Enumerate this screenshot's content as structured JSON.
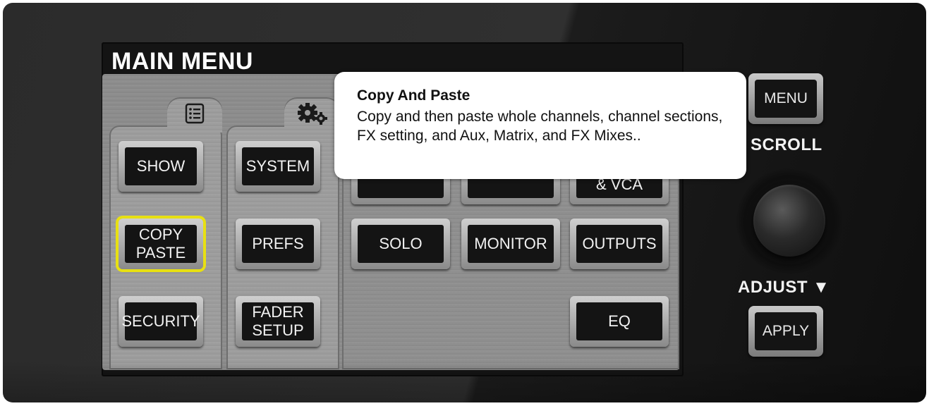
{
  "screen": {
    "title": "MAIN MENU"
  },
  "menu": {
    "col1": [
      "SHOW",
      "COPY\nPASTE",
      "SECURITY"
    ],
    "col2": [
      "SYSTEM",
      "PREFS",
      "FADER\nSETUP"
    ],
    "col3": [
      "",
      "SOLO"
    ],
    "col4": [
      "",
      "MONITOR"
    ],
    "col5": [
      "& VCA",
      "OUTPUTS",
      "EQ"
    ],
    "selected": "COPY\nPASTE",
    "selected_color": "#e8e012"
  },
  "tabs": {
    "left_icon": "list-settings-icon",
    "right_icon": "gears-icon"
  },
  "tooltip": {
    "title": "Copy And Paste",
    "text": "Copy and then paste whole channels, channel sections, FX setting, and Aux, Matrix, and FX Mixes.."
  },
  "controls": {
    "menu_button": "MENU",
    "scroll_label": "SCROLL",
    "adjust_label": "ADJUST ▼",
    "apply_button": "APPLY"
  }
}
